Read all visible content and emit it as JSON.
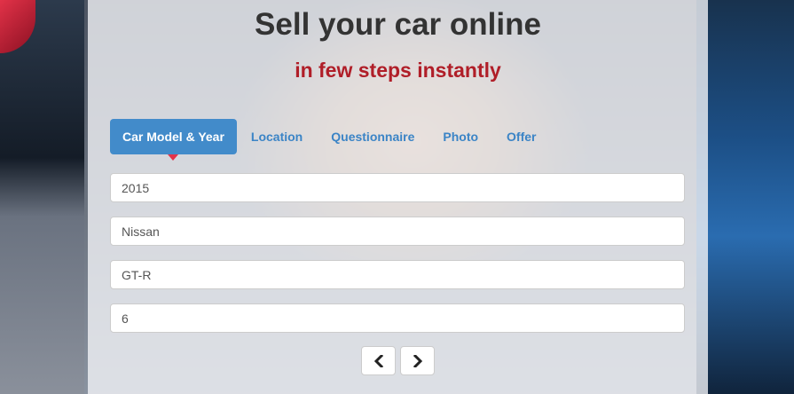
{
  "header": {
    "title": "Sell your car online",
    "subtitle": "in few steps instantly"
  },
  "tabs": [
    {
      "label": "Car Model & Year",
      "active": true
    },
    {
      "label": "Location",
      "active": false
    },
    {
      "label": "Questionnaire",
      "active": false
    },
    {
      "label": "Photo",
      "active": false
    },
    {
      "label": "Offer",
      "active": false
    }
  ],
  "form": {
    "year": "2015",
    "make": "Nissan",
    "model": "GT-R",
    "cylinders": "6"
  },
  "nav": {
    "prev_icon": "chevron-left-icon",
    "next_icon": "chevron-right-icon"
  },
  "colors": {
    "accent": "#428bca",
    "subtitle": "#b01e28",
    "indicator": "#e4334a"
  }
}
